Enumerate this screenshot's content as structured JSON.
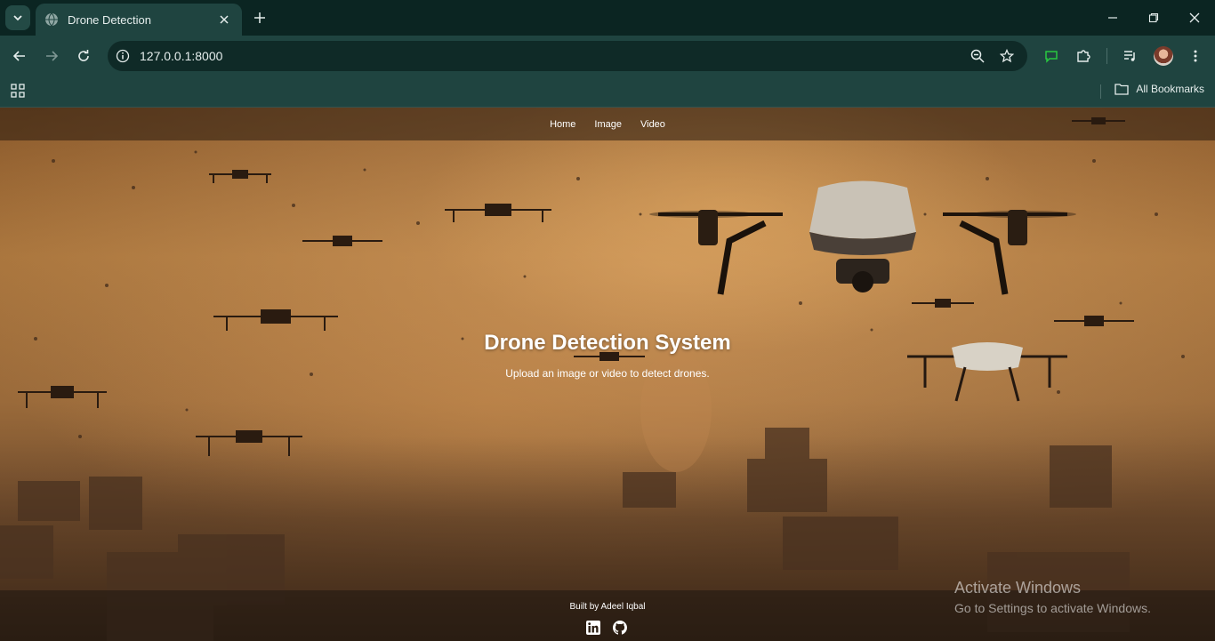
{
  "browser": {
    "tab_title": "Drone Detection",
    "url": "127.0.0.1:8000",
    "bookmarks_label": "All Bookmarks"
  },
  "nav": {
    "items": [
      {
        "label": "Home"
      },
      {
        "label": "Image"
      },
      {
        "label": "Video"
      }
    ]
  },
  "hero": {
    "title": "Drone Detection System",
    "subtitle": "Upload an image or video to detect drones."
  },
  "footer": {
    "credit": "Built by Adeel Iqbal",
    "icons": [
      "linkedin-icon",
      "github-icon"
    ]
  },
  "watermark": {
    "line1": "Activate Windows",
    "line2": "Go to Settings to activate Windows."
  },
  "colors": {
    "chrome_dark": "#0b2522",
    "chrome": "#1f4440",
    "omnibox": "#0f2a27",
    "sky": "#a8743c"
  }
}
